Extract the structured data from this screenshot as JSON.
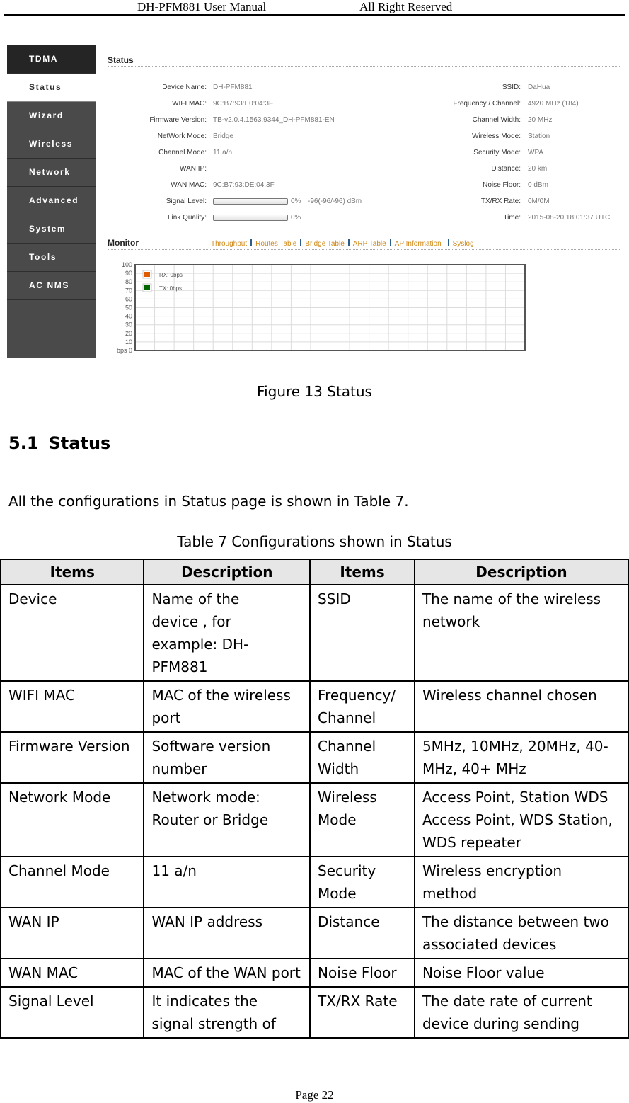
{
  "page_header": {
    "left": "DH-PFM881 User Manual",
    "right": "All Right Reserved"
  },
  "figure": {
    "sidebar": {
      "items": [
        {
          "label": "TDMA",
          "state": "brand"
        },
        {
          "label": "Status",
          "state": "active"
        },
        {
          "label": "Wizard",
          "state": "normal"
        },
        {
          "label": "Wireless",
          "state": "normal"
        },
        {
          "label": "Network",
          "state": "normal"
        },
        {
          "label": "Advanced",
          "state": "normal"
        },
        {
          "label": "System",
          "state": "normal"
        },
        {
          "label": "Tools",
          "state": "normal"
        },
        {
          "label": "AC NMS",
          "state": "normal"
        }
      ]
    },
    "status": {
      "title": "Status",
      "left_fields": [
        {
          "label": "Device Name:",
          "value": "DH-PFM881"
        },
        {
          "label": "WIFI MAC:",
          "value": "9C:B7:93:E0:04:3F"
        },
        {
          "label": "Firmware Version:",
          "value": "TB-v2.0.4.1563.9344_DH-PFM881-EN"
        },
        {
          "label": "NetWork Mode:",
          "value": "Bridge"
        },
        {
          "label": "Channel Mode:",
          "value": "11 a/n"
        },
        {
          "label": "WAN IP:",
          "value": ""
        },
        {
          "label": "WAN MAC:",
          "value": "9C:B7:93:DE:04:3F"
        }
      ],
      "signal_level": {
        "label": "Signal Level:",
        "percent": 0,
        "percent_text": "0%",
        "extra": "-96(-96/-96) dBm"
      },
      "link_quality": {
        "label": "Link Quality:",
        "percent": 0,
        "percent_text": "0%"
      },
      "right_fields": [
        {
          "label": "SSID:",
          "value": "DaHua"
        },
        {
          "label": "Frequency / Channel:",
          "value": "4920 MHz (184)"
        },
        {
          "label": "Channel Width:",
          "value": "20 MHz"
        },
        {
          "label": "Wireless Mode:",
          "value": "Station"
        },
        {
          "label": "Security Mode:",
          "value": "WPA"
        },
        {
          "label": "Distance:",
          "value": "20 km"
        },
        {
          "label": "Noise Floor:",
          "value": "0 dBm"
        },
        {
          "label": "TX/RX Rate:",
          "value": "0M/0M"
        },
        {
          "label": "Time:",
          "value": "2015-08-20 18:01:37 UTC"
        }
      ]
    },
    "monitor": {
      "title": "Monitor",
      "tabs": [
        "Throughput",
        "Routes Table",
        "Bridge Table",
        "ARP Table",
        "AP Information",
        "Syslog"
      ],
      "separator_color": "#2a5d8a",
      "tab_color": "#d08a1a"
    },
    "chart_data": {
      "type": "line",
      "title": "",
      "xlabel": "",
      "ylabel": "bps",
      "ylim": [
        0,
        100
      ],
      "yticks": [
        0,
        10,
        20,
        30,
        40,
        50,
        60,
        70,
        80,
        90,
        100
      ],
      "ytick_labels": [
        "bps 0",
        "10",
        "20",
        "30",
        "40",
        "50",
        "60",
        "70",
        "80",
        "90",
        "100"
      ],
      "grid": true,
      "legend_position": "top-left",
      "x": [
        0,
        1,
        2
      ],
      "series": [
        {
          "name": "RX: 0bps",
          "color": "#e05a00",
          "values": [
            0,
            0,
            0
          ]
        },
        {
          "name": "TX: 0bps",
          "color": "#006600",
          "values": [
            0,
            0,
            0
          ]
        }
      ]
    }
  },
  "figure_caption": "Figure 13 Status",
  "section": {
    "number": "5.1",
    "title": "Status"
  },
  "intro": "All the configurations in Status page is shown in Table 7.",
  "table": {
    "caption": "Table 7 Configurations shown in Status",
    "headers": [
      "Items",
      "Description",
      "Items",
      "Description"
    ],
    "rows": [
      [
        "Device",
        "Name of the device , for example: DH-PFM881",
        "SSID",
        "The name of the wireless network"
      ],
      [
        "WIFI MAC",
        "MAC of the wireless port",
        "Frequency/ Channel",
        "Wireless channel chosen"
      ],
      [
        "Firmware Version",
        "Software version number",
        "Channel Width",
        "5MHz, 10MHz, 20MHz, 40- MHz, 40+ MHz"
      ],
      [
        "Network Mode",
        "Network mode: Router or Bridge",
        "Wireless Mode",
        "Access Point, Station WDS Access Point, WDS Station, WDS repeater"
      ],
      [
        "Channel Mode",
        "11 a/n",
        "Security Mode",
        "Wireless encryption method"
      ],
      [
        "WAN IP",
        "WAN IP address",
        "Distance",
        "The distance between two associated devices"
      ],
      [
        "WAN MAC",
        "MAC of the WAN port",
        "Noise Floor",
        "Noise Floor value"
      ],
      [
        "Signal Level",
        "It indicates the signal strength of",
        "TX/RX Rate",
        "The date rate of current device during sending"
      ]
    ]
  },
  "footer": "Page 22"
}
